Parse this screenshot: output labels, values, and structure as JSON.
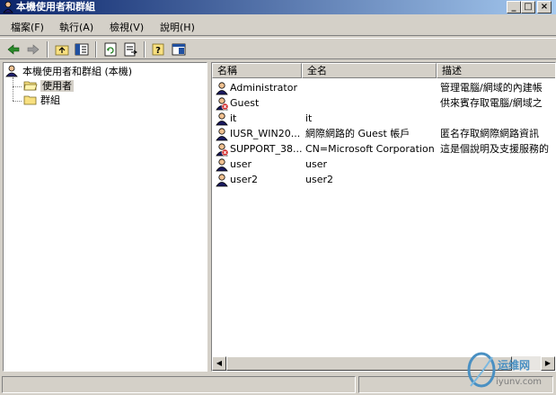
{
  "window": {
    "title": "本機使用者和群組"
  },
  "menu": [
    {
      "label": "檔案(F)"
    },
    {
      "label": "執行(A)"
    },
    {
      "label": "檢視(V)"
    },
    {
      "label": "說明(H)"
    }
  ],
  "toolbar": {
    "icons": [
      "back-arrow-icon",
      "forward-arrow-icon",
      "up-folder-icon",
      "show-tree-icon",
      "refresh-icon",
      "export-list-icon",
      "help-icon",
      "properties-icon"
    ]
  },
  "tree": {
    "root_label": "本機使用者和群組 (本機)",
    "items": [
      {
        "label": "使用者",
        "selected": true
      },
      {
        "label": "群組",
        "selected": false
      }
    ]
  },
  "list": {
    "columns": [
      "名稱",
      "全名",
      "描述"
    ],
    "rows": [
      {
        "name": "Administrator",
        "full_name": "",
        "description": "管理電腦/網域的內建帳",
        "disabled": false
      },
      {
        "name": "Guest",
        "full_name": "",
        "description": "供來賓存取電腦/網域之",
        "disabled": true
      },
      {
        "name": "it",
        "full_name": "it",
        "description": "",
        "disabled": false
      },
      {
        "name": "IUSR_WIN20...",
        "full_name": "網際網路的 Guest 帳戶",
        "description": "匿名存取網際網路資訊",
        "disabled": false
      },
      {
        "name": "SUPPORT_38...",
        "full_name": "CN=Microsoft Corporation...",
        "description": "這是個說明及支援服務的",
        "disabled": true
      },
      {
        "name": "user",
        "full_name": "user",
        "description": "",
        "disabled": false
      },
      {
        "name": "user2",
        "full_name": "user2",
        "description": "",
        "disabled": false
      }
    ]
  },
  "watermark": {
    "line1": "运维网",
    "line2": "iyunv.com"
  },
  "colors": {
    "titlebar_start": "#0a246a",
    "titlebar_end": "#a6caf0",
    "chrome": "#d4d0c8"
  }
}
